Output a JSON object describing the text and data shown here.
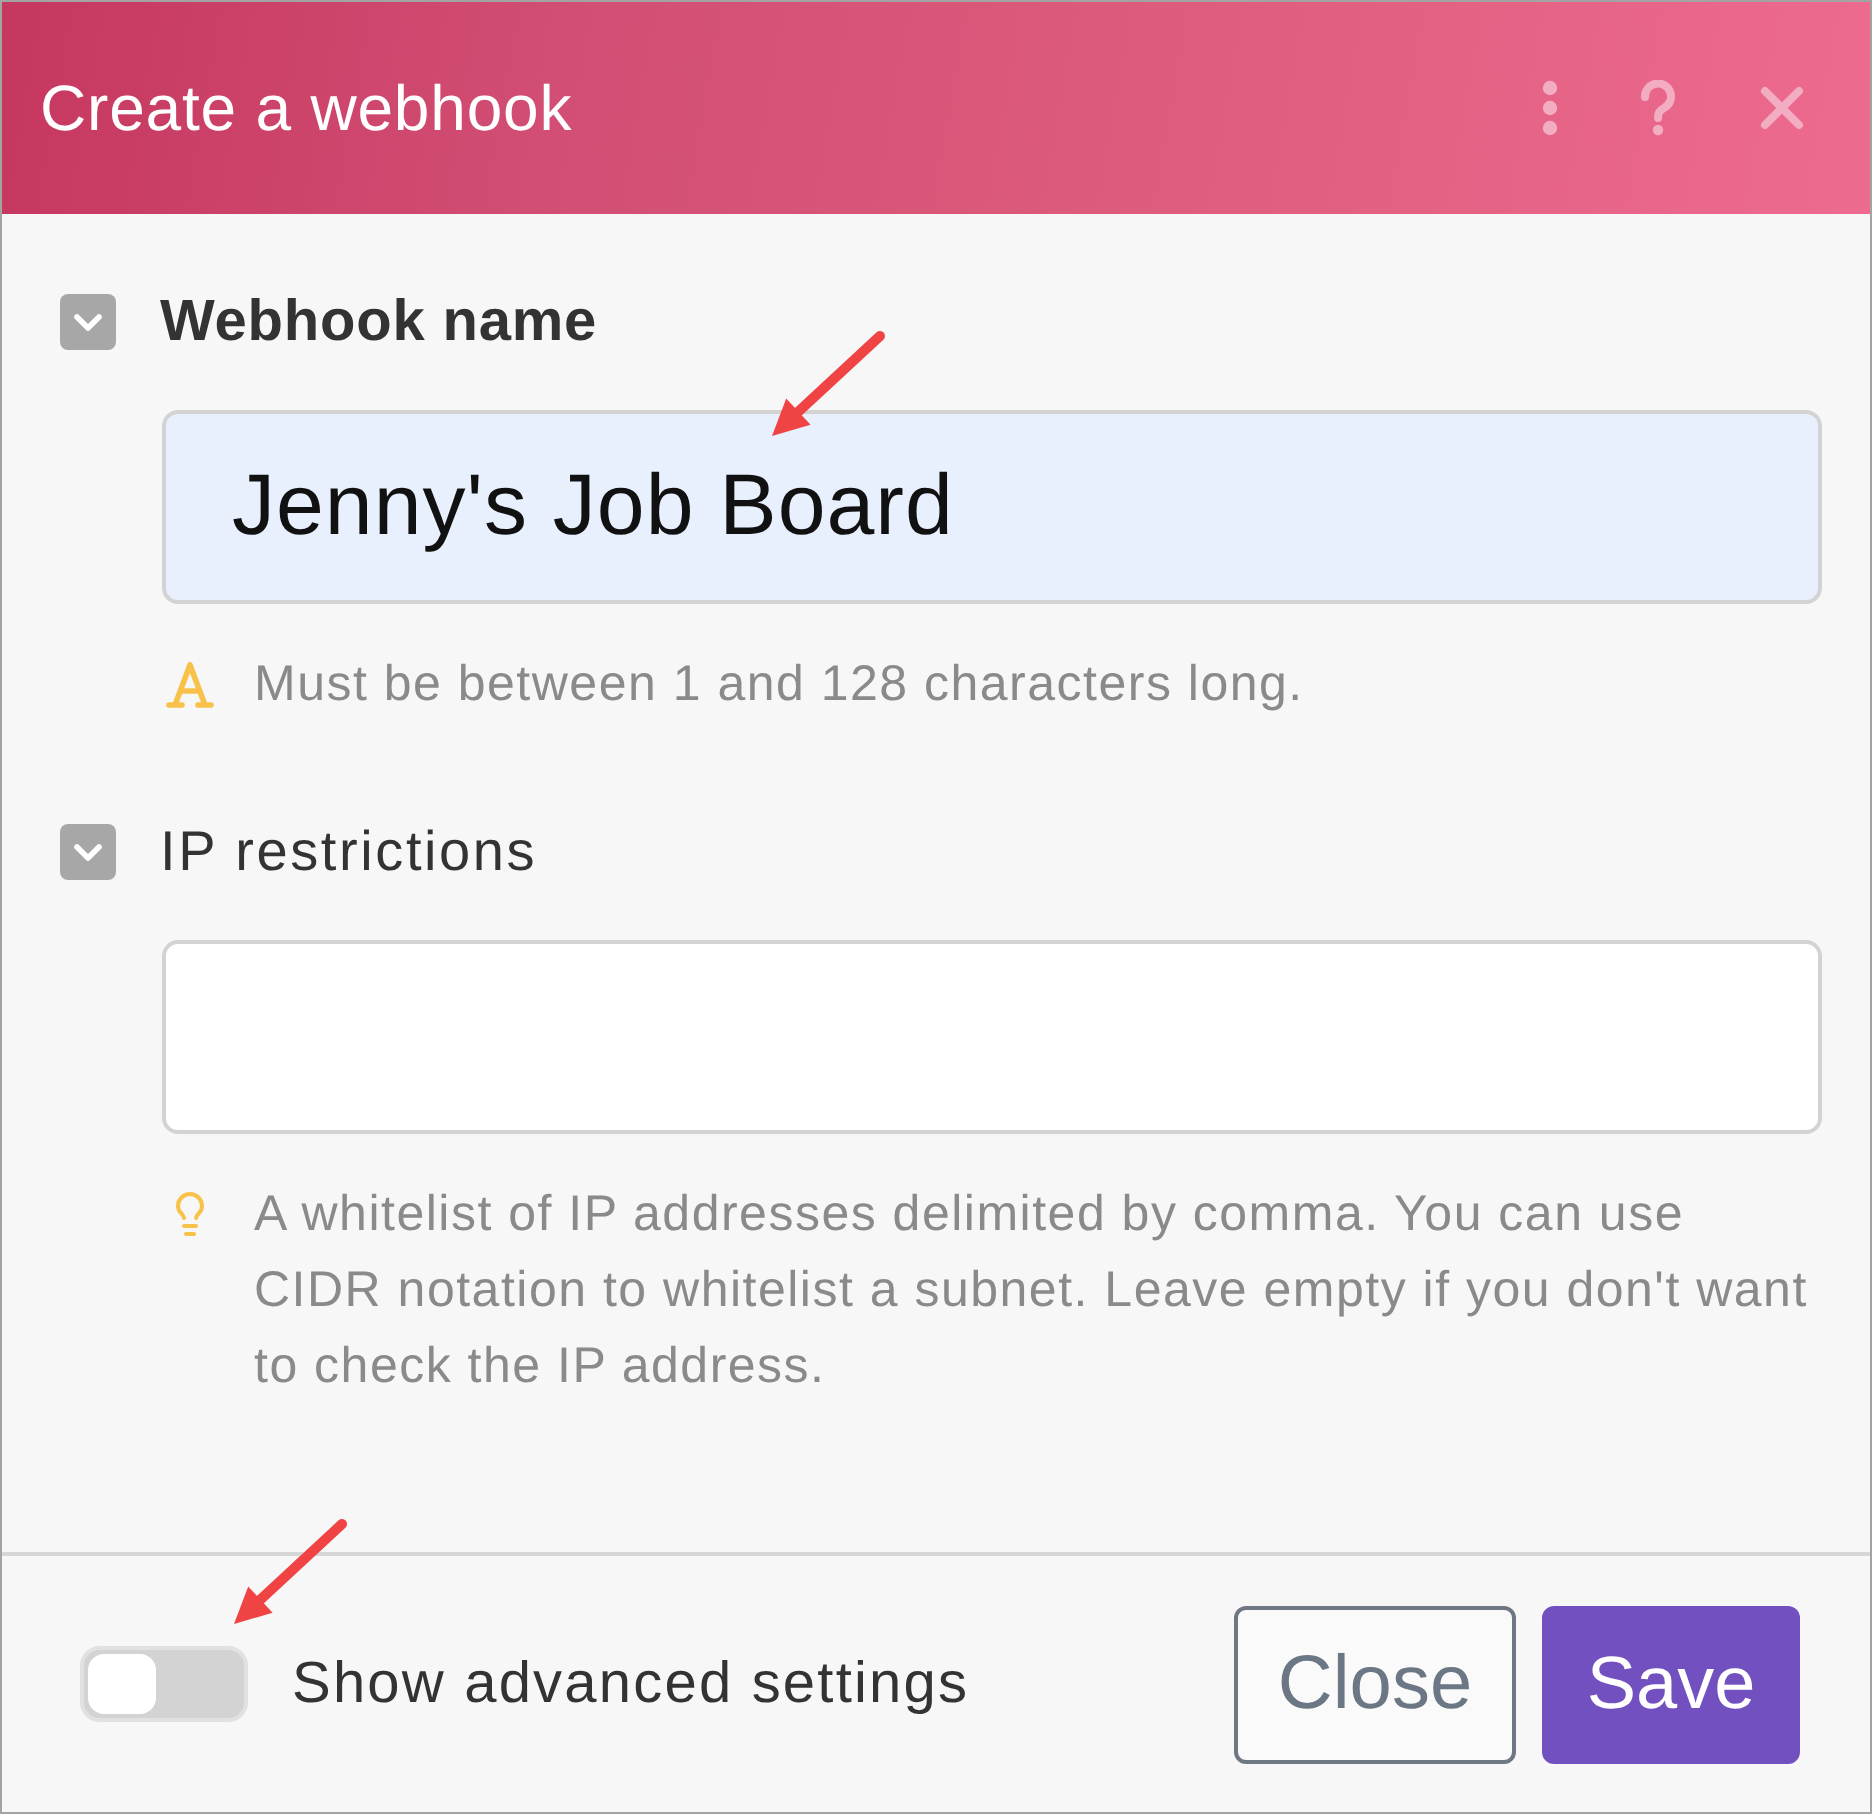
{
  "header": {
    "title": "Create a webhook"
  },
  "fields": [
    {
      "label": "Webhook name",
      "required": true,
      "expanded": true,
      "value": "Jenny's Job Board",
      "autofilled": true,
      "annotated": true,
      "hint": {
        "kind": "length",
        "text": "Must be between 1 and 128 characters long."
      }
    },
    {
      "label": "IP restrictions",
      "required": false,
      "expanded": true,
      "autofilled": false,
      "annotated": false,
      "hint": {
        "kind": "tip",
        "text": "A whitelist of IP addresses delimited by comma. You can use CIDR notation to whitelist a subnet. Leave empty if you don't want to check the IP address."
      }
    }
  ],
  "footer": {
    "toggle": {
      "label": "Show advanced settings",
      "on": false,
      "annotated": true
    },
    "buttons": [
      {
        "label": "Close",
        "kind": "secondary"
      },
      {
        "label": "Save",
        "kind": "primary"
      }
    ]
  }
}
